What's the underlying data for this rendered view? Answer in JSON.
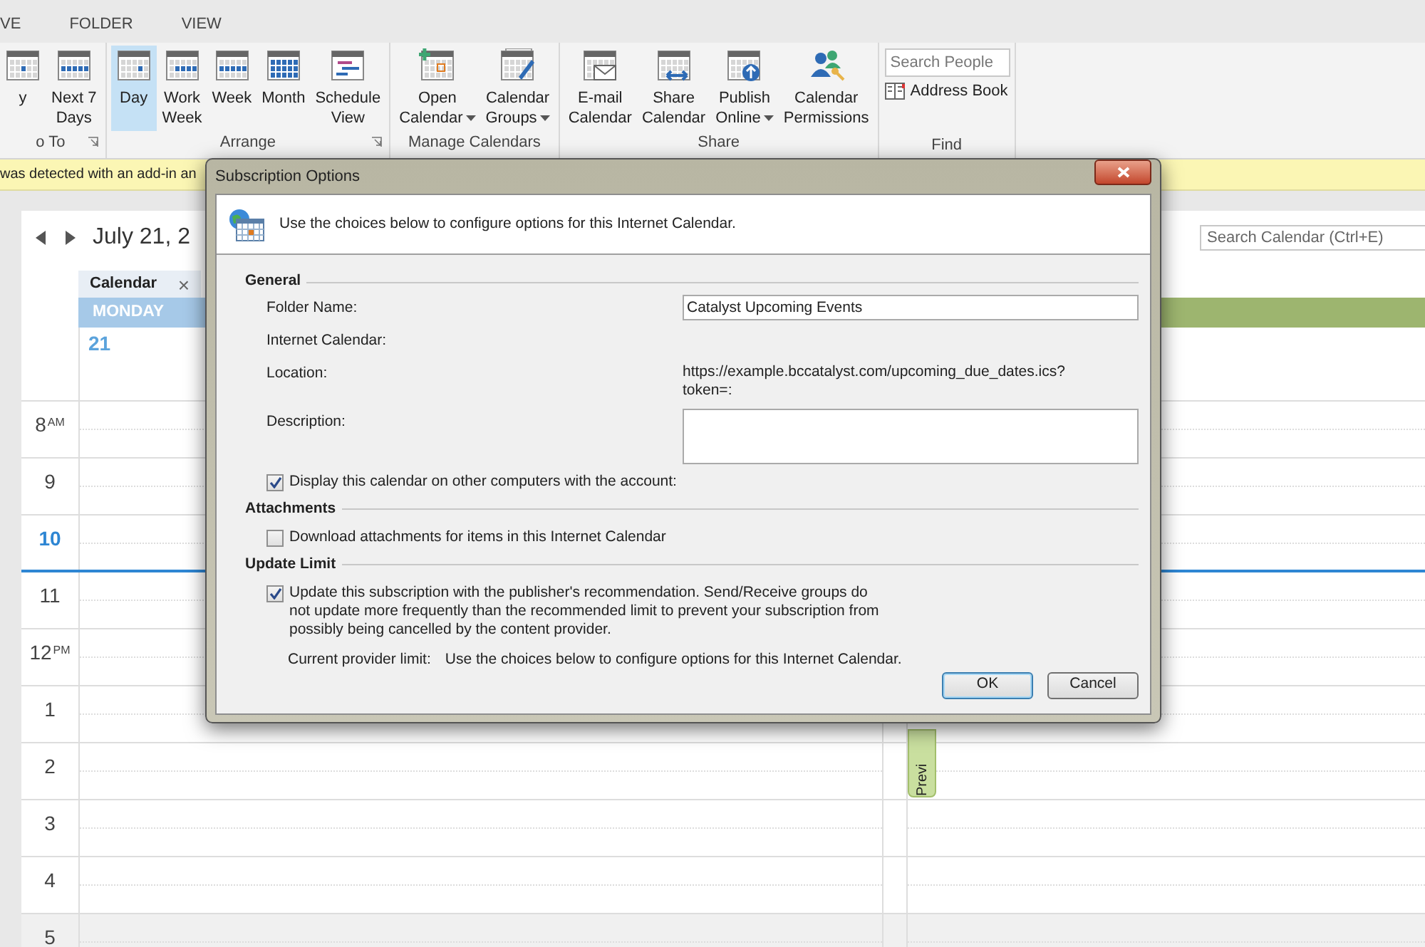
{
  "ribbon_tabs": [
    {
      "label": "VE",
      "selected": false
    },
    {
      "label": "FOLDER",
      "selected": false
    },
    {
      "label": "VIEW",
      "selected": false
    }
  ],
  "ribbon_groups": [
    {
      "label": "o To",
      "buttons": [
        {
          "lines": [
            "y"
          ],
          "selected": false,
          "dropdown": false
        },
        {
          "lines": [
            "Next 7",
            "Days"
          ],
          "selected": false,
          "dropdown": false
        }
      ]
    },
    {
      "label": "Arrange",
      "buttons": [
        {
          "lines": [
            "Day"
          ],
          "selected": true,
          "dropdown": false
        },
        {
          "lines": [
            "Work",
            "Week"
          ],
          "selected": false,
          "dropdown": false
        },
        {
          "lines": [
            "Week"
          ],
          "selected": false,
          "dropdown": false
        },
        {
          "lines": [
            "Month"
          ],
          "selected": false,
          "dropdown": false
        },
        {
          "lines": [
            "Schedule",
            "View"
          ],
          "selected": false,
          "dropdown": false
        }
      ]
    },
    {
      "label": "Manage Calendars",
      "buttons": [
        {
          "lines": [
            "Open",
            "Calendar"
          ],
          "selected": false,
          "dropdown": true
        },
        {
          "lines": [
            "Calendar",
            "Groups"
          ],
          "selected": false,
          "dropdown": true
        }
      ]
    },
    {
      "label": "Share",
      "buttons": [
        {
          "lines": [
            "E-mail",
            "Calendar"
          ],
          "selected": false,
          "dropdown": false
        },
        {
          "lines": [
            "Share",
            "Calendar"
          ],
          "selected": false,
          "dropdown": false
        },
        {
          "lines": [
            "Publish",
            "Online"
          ],
          "selected": false,
          "dropdown": true
        },
        {
          "lines": [
            "Calendar",
            "Permissions"
          ],
          "selected": false,
          "dropdown": false
        }
      ]
    }
  ],
  "find": {
    "label": "Find",
    "search": {
      "placeholder": "Search People"
    },
    "address_book": "Address Book"
  },
  "info_bar": {
    "text": "was detected with an add-in an"
  },
  "calendar": {
    "date": "July 21, 2",
    "search": {
      "placeholder": "Search Calendar (Ctrl+E)"
    },
    "tab": {
      "label": "Calendar",
      "close": "×"
    },
    "day_header": "MONDAY",
    "day_number": "21",
    "hours": [
      {
        "hour": "8",
        "suffix": "AM",
        "current": false,
        "off_hours": false
      },
      {
        "hour": "9",
        "current": false,
        "off_hours": false
      },
      {
        "hour": "10",
        "current": true,
        "off_hours": false
      },
      {
        "hour": "11",
        "current": false,
        "off_hours": false
      },
      {
        "hour": "12",
        "suffix": "PM",
        "current": false,
        "off_hours": false
      },
      {
        "hour": "1",
        "current": false,
        "off_hours": false
      },
      {
        "hour": "2",
        "current": false,
        "off_hours": false
      },
      {
        "hour": "3",
        "current": false,
        "off_hours": false
      },
      {
        "hour": "4",
        "current": false,
        "off_hours": false
      },
      {
        "hour": "5",
        "current": false,
        "off_hours": true
      }
    ],
    "event": {
      "label": "Previ"
    }
  },
  "dialog": {
    "title": "Subscription Options",
    "intro": "Use the choices below to configure options for this Internet Calendar.",
    "sections": [
      {
        "title": "General",
        "rows": [
          {
            "kind": "field",
            "label": "Folder Name:",
            "value": "Catalyst Upcoming Events"
          },
          {
            "kind": "label",
            "label": "Internet Calendar:"
          },
          {
            "kind": "value",
            "label": "Location:",
            "lines": [
              "https://example.bccatalyst.com/upcoming_due_dates.ics?",
              "token=:"
            ]
          },
          {
            "kind": "textarea",
            "label": "Description:"
          },
          {
            "kind": "checkbox",
            "label": "Display this calendar on other computers with the account:",
            "checked": true
          }
        ]
      },
      {
        "title": "Attachments",
        "rows": [
          {
            "kind": "checkbox",
            "label": "Download attachments for items in this Internet Calendar",
            "checked": false
          }
        ]
      },
      {
        "title": "Update Limit",
        "rows": [
          {
            "kind": "checkbox",
            "label": "Update this subscription with the publisher's recommendation. Send/Receive groups do not update more frequently than the recommended limit to prevent your subscription from possibly being cancelled by the content provider.",
            "checked": true
          },
          {
            "kind": "info",
            "label": "Current provider limit:",
            "value": "Use the choices below to configure options for this Internet Calendar."
          }
        ]
      }
    ],
    "buttons": [
      {
        "label": "OK",
        "default": true
      },
      {
        "label": "Cancel",
        "default": false
      }
    ]
  }
}
